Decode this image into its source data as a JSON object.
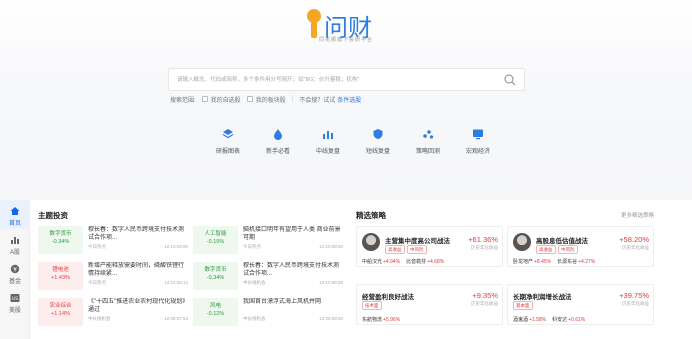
{
  "brand": {
    "name": "i问财",
    "tagline": "同花顺旗下投研平台"
  },
  "search": {
    "placeholder": "请输入概念、代码或简称，多个条件用分号隔开，如\"BG；价升量稳；机构\"",
    "scope_label": "搜索范围:",
    "options": [
      "我的自选股",
      "我的板块股"
    ],
    "hint": "不会搜？试试",
    "hint_link": "条件选股"
  },
  "tools": [
    {
      "label": "研报图表",
      "icon": "layers-icon"
    },
    {
      "label": "新手必看",
      "icon": "drop-icon"
    },
    {
      "label": "中线复盘",
      "icon": "bar-chart-icon"
    },
    {
      "label": "短线复盘",
      "icon": "shield-icon"
    },
    {
      "label": "策略回测",
      "icon": "scatter-icon"
    },
    {
      "label": "宏观经济",
      "icon": "screen-icon"
    }
  ],
  "sidebar": [
    {
      "label": "首页",
      "icon": "home-icon",
      "active": true
    },
    {
      "label": "A股",
      "icon": "chart-icon",
      "active": false
    },
    {
      "label": "基金",
      "icon": "fund-icon",
      "active": false
    },
    {
      "label": "美股",
      "icon": "us-icon",
      "active": false
    }
  ],
  "theme": {
    "title": "主题投资",
    "items": [
      {
        "tag": "数字货币",
        "pct": "-0.34%",
        "trend": "green",
        "text": "穆长春：数字人民币跨境支付技术测试合作项...",
        "source": "今日热点",
        "time": "12:10:08:00"
      },
      {
        "tag": "人工智能",
        "pct": "-0.19%",
        "trend": "green",
        "text": "脑机接口明年有望用于人类 商业前景可期",
        "source": "今日热点",
        "time": "12:10:08:00"
      },
      {
        "tag": "锂电池",
        "pct": "+1.43%",
        "trend": "red",
        "text": "新增产能释放需要时间，磷酸铁锂行情持续紧...",
        "source": "今日热点",
        "time": "12:10:08:12"
      },
      {
        "tag": "数字货币",
        "pct": "-0.34%",
        "trend": "green",
        "text": "穆长春：数字人民币跨境支付技术测试合作项...",
        "source": "中长线机会",
        "time": "12:10:08:05"
      },
      {
        "tag": "农业综合",
        "pct": "+1.14%",
        "trend": "red",
        "text": "《\"十四五\"推进农业农村现代化规划》通过",
        "source": "中长线机会",
        "time": "12:09:07:54"
      },
      {
        "tag": "风电",
        "pct": "-0.12%",
        "trend": "green",
        "text": "我国首台漂浮式海上风机并网",
        "source": "中长线机会",
        "time": "12:09:08:00"
      }
    ]
  },
  "picks": {
    "title": "精选策略",
    "more": "更多精选策略",
    "cards": [
      {
        "name": "主营集中度高公司战法",
        "pct": "+61.36%",
        "sub": "历史年化收益",
        "chips": [
          "高收益",
          "中风险"
        ],
        "stocks": [
          {
            "n": "中船汉光",
            "p": "+4.94%"
          },
          {
            "n": "比音勒芬",
            "p": "+4.68%"
          }
        ],
        "avatar": true
      },
      {
        "name": "高股息低估值战法",
        "pct": "+58.20%",
        "sub": "历史年化收益",
        "chips": [
          "高收益",
          "中风险"
        ],
        "stocks": [
          {
            "n": "卧龙地产",
            "p": "+8.45%"
          },
          {
            "n": "长源东谷",
            "p": "+4.27%"
          }
        ],
        "avatar": true
      },
      {
        "name": "经营盈利良好战法",
        "pct": "+9.35%",
        "sub": "历史年化收益",
        "chips": [
          "技术面"
        ],
        "stocks": [
          {
            "n": "东航物流",
            "p": "+5.96%"
          }
        ],
        "avatar": false
      },
      {
        "name": "长期净利润增长战法",
        "pct": "+39.75%",
        "sub": "历史年化收益",
        "chips": [
          "基本面"
        ],
        "stocks": [
          {
            "n": "酒鬼酒",
            "p": "+1.58%"
          },
          {
            "n": "科安达",
            "p": "+0.61%"
          }
        ],
        "avatar": false
      }
    ]
  },
  "colors": {
    "accent": "#1a66e8",
    "up": "#e03b3b",
    "down": "#2b9a3f",
    "logo_blue": "#2f7de1",
    "logo_gold": "#f5a623"
  }
}
